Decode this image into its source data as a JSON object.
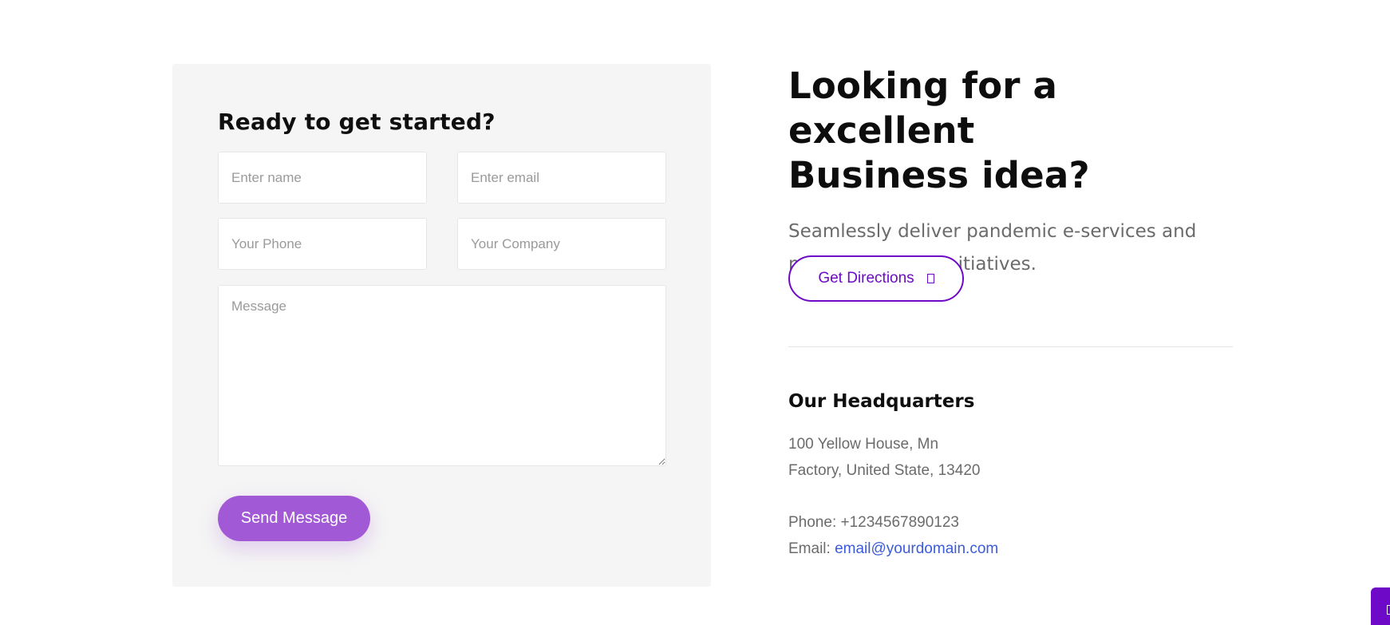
{
  "form": {
    "title": "Ready to get started?",
    "name_placeholder": "Enter name",
    "email_placeholder": "Enter email",
    "phone_placeholder": "Your Phone",
    "company_placeholder": "Your Company",
    "message_placeholder": "Message",
    "submit_label": "Send Message"
  },
  "info": {
    "headline_line1": "Looking for a excellent",
    "headline_line2": "Business idea?",
    "lead": "Seamlessly deliver pandemic e-services and next-generation initiatives.",
    "directions_label": "Get Directions",
    "directions_icon": "arrow-icon"
  },
  "headquarters": {
    "title": "Our Headquarters",
    "address_line1": "100 Yellow House, Mn",
    "address_line2": "Factory, United State, 13420",
    "phone_label": "Phone:",
    "phone": "+1234567890123",
    "email_label": "Email:",
    "email": "email@yourdomain.com"
  },
  "colors": {
    "accent": "#6e0ac7",
    "button": "#a259d6",
    "link": "#3b5bd9"
  }
}
